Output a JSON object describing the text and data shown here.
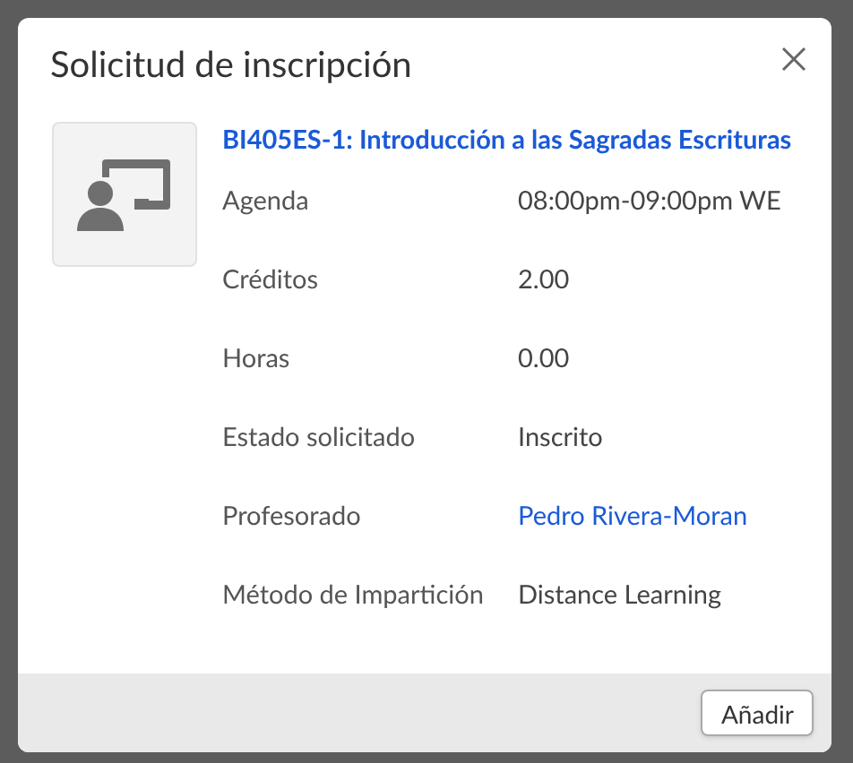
{
  "dialog": {
    "title": "Solicitud de inscripción",
    "course": {
      "title": "BI405ES-1: Introducción a las Sagradas Escrituras"
    },
    "details": [
      {
        "label": "Agenda",
        "value": "08:00pm-09:00pm WE",
        "kind": "text"
      },
      {
        "label": "Créditos",
        "value": "2.00",
        "kind": "text"
      },
      {
        "label": "Horas",
        "value": "0.00",
        "kind": "text"
      },
      {
        "label": "Estado solicitado",
        "value": "Inscrito",
        "kind": "text"
      },
      {
        "label": "Profesorado",
        "value": "Pedro Rivera-Moran",
        "kind": "link"
      },
      {
        "label": "Método de Impartición",
        "value": "Distance Learning",
        "kind": "text"
      }
    ],
    "buttons": [
      "Añadir"
    ]
  }
}
